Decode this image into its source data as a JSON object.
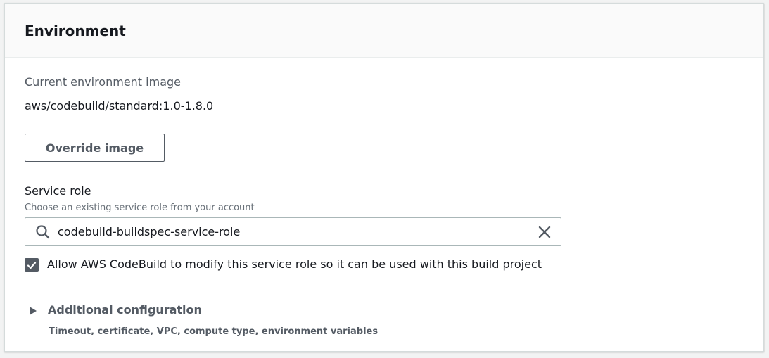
{
  "panel": {
    "title": "Environment"
  },
  "environment": {
    "current_image_label": "Current environment image",
    "current_image_value": "aws/codebuild/standard:1.0-1.8.0",
    "override_button_label": "Override image"
  },
  "service_role": {
    "label": "Service role",
    "description": "Choose an existing service role from your account",
    "search_value": "codebuild-buildspec-service-role",
    "search_icon": "search-icon",
    "clear_icon": "close-icon"
  },
  "allow_modify": {
    "checked": true,
    "label": "Allow AWS CodeBuild to modify this service role so it can be used with this build project"
  },
  "additional_configuration": {
    "title": "Additional configuration",
    "description": "Timeout, certificate, VPC, compute type, environment variables",
    "expanded": false,
    "caret_icon": "caret-right-icon"
  },
  "colors": {
    "header_bg": "#fafafa",
    "border": "#d5dbdb",
    "muted_text": "#545b64",
    "text": "#16191f",
    "checkbox_bg": "#545b64"
  }
}
